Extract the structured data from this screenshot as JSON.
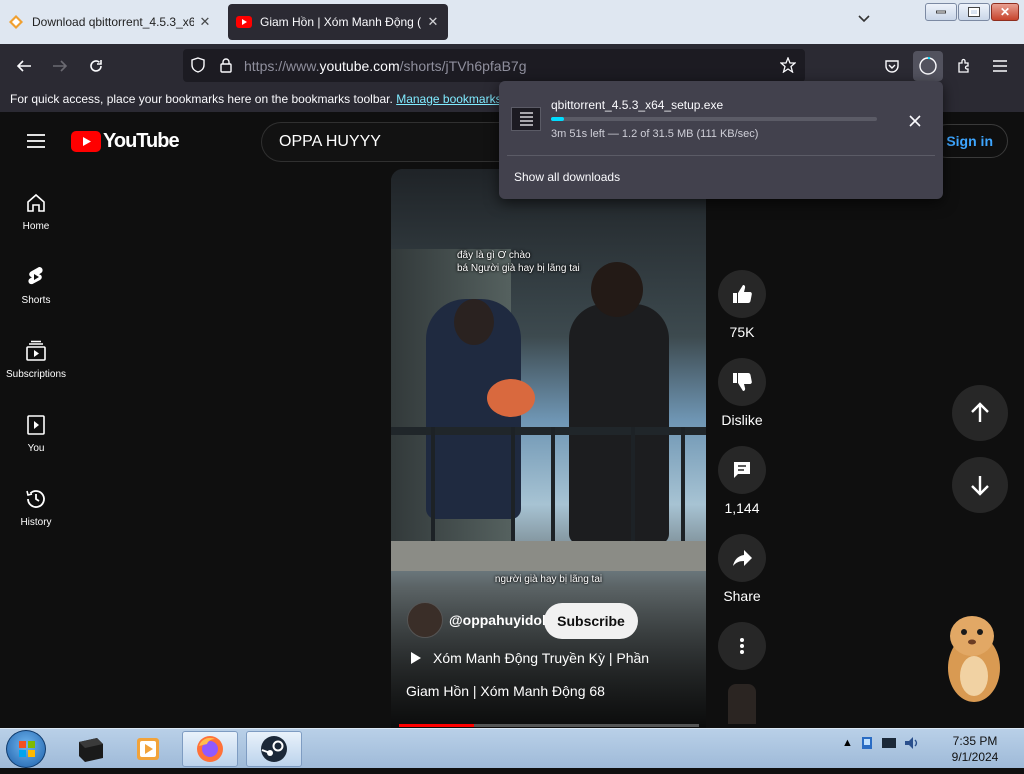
{
  "browser": {
    "tabs": [
      {
        "label": "Download qbittorrent_4.5.3_x64",
        "active": false,
        "favicon": "download-site-icon"
      },
      {
        "label": "Giam Hồn | Xóm Manh Động (",
        "active": true,
        "favicon": "youtube-icon"
      }
    ],
    "url_prefix": "https://www.",
    "url_host": "youtube.com",
    "url_path": "/shorts/jTVh6pfaB7g",
    "bookmarks_hint": "For quick access, place your bookmarks here on the bookmarks toolbar.",
    "bookmarks_link": "Manage bookmarks..."
  },
  "youtube": {
    "logo_text": "YouTube",
    "search_value": "OPPA HUYYY",
    "signin_label": "Sign in",
    "sidebar": [
      {
        "label": "Home",
        "icon": "home-icon"
      },
      {
        "label": "Shorts",
        "icon": "shorts-icon"
      },
      {
        "label": "Subscriptions",
        "icon": "subscriptions-icon"
      },
      {
        "label": "You",
        "icon": "you-icon"
      },
      {
        "label": "History",
        "icon": "history-icon"
      }
    ],
    "short": {
      "subtitle_top_1": "đây là gì Ơ chào",
      "subtitle_top_2": "bá Người già hay bị lãng tai",
      "subtitle_bottom": "người già hay bị lãng tai",
      "channel": "@oppahuyidol",
      "subscribe_label": "Subscribe",
      "playlist": "Xóm Manh Động Truyền Kỳ | Phần",
      "title": "Giam Hồn | Xóm Manh Động 68",
      "progress_fraction": 0.25
    },
    "actions": {
      "like_count": "75K",
      "dislike_label": "Dislike",
      "comments_count": "1,144",
      "share_label": "Share"
    }
  },
  "downloads": {
    "filename": "qbittorrent_4.5.3_x64_setup.exe",
    "status": "3m 51s left — 1.2 of 31.5 MB (111 KB/sec)",
    "progress_fraction": 0.04,
    "show_all": "Show all downloads"
  },
  "taskbar": {
    "time": "7:35 PM",
    "date": "9/1/2024"
  },
  "colors": {
    "accent_youtube": "#ff0000",
    "download_progress": "#00ddff",
    "link": "#3ea6ff"
  }
}
